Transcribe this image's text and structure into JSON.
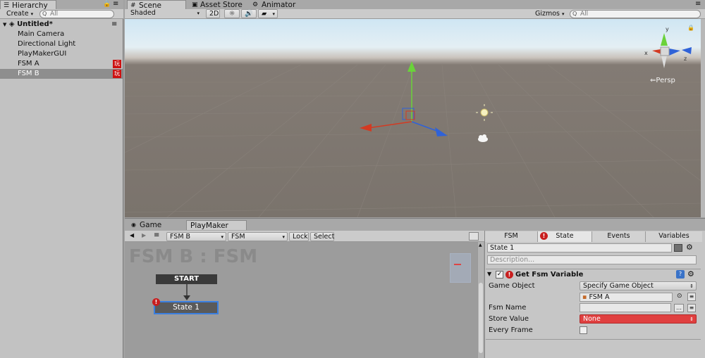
{
  "hierarchy": {
    "tab_label": "Hierarchy",
    "create_label": "Create",
    "search_placeholder": "All",
    "scene_name": "Untitled*",
    "items": [
      {
        "label": "Main Camera"
      },
      {
        "label": "Directional Light"
      },
      {
        "label": "PlayMakerGUI"
      },
      {
        "label": "FSM A",
        "badge": "玩"
      },
      {
        "label": "FSM B",
        "badge": "玩"
      }
    ]
  },
  "top_tabs": {
    "scene": "Scene",
    "asset_store": "Asset Store",
    "animator": "Animator"
  },
  "scene_toolbar": {
    "shading": "Shaded",
    "mode_2d": "2D",
    "gizmos": "Gizmos",
    "search_placeholder": "All"
  },
  "scene_view": {
    "persp_label": "Persp",
    "gizmo_axis_y": "y",
    "gizmo_axis_x": "x",
    "gizmo_axis_z": "z"
  },
  "bottom_tabs": {
    "game": "Game",
    "playmaker": "PlayMaker"
  },
  "playmaker_toolbar": {
    "object_select": "FSM B",
    "fsm_select": "FSM",
    "lock_label": "Lock",
    "select_label": "Select"
  },
  "graph": {
    "title": "FSM B : FSM",
    "start_label": "START",
    "state_label": "State 1"
  },
  "inspector": {
    "tabs": {
      "fsm": "FSM",
      "state": "State",
      "events": "Events",
      "variables": "Variables"
    },
    "state_name": "State 1",
    "description_placeholder": "Description...",
    "action_title": "Get Fsm Variable",
    "fields": {
      "game_object_label": "Game Object",
      "game_object_value": "Specify Game Object",
      "fsm_a_value": "FSM A",
      "fsm_name_label": "Fsm Name",
      "fsm_name_value": "",
      "store_value_label": "Store Value",
      "store_value_value": "None",
      "every_frame_label": "Every Frame"
    }
  },
  "colors": {
    "accent_red": "#e04040",
    "state_highlight": "#3b7fe0",
    "selection": "#8e8e8e"
  }
}
